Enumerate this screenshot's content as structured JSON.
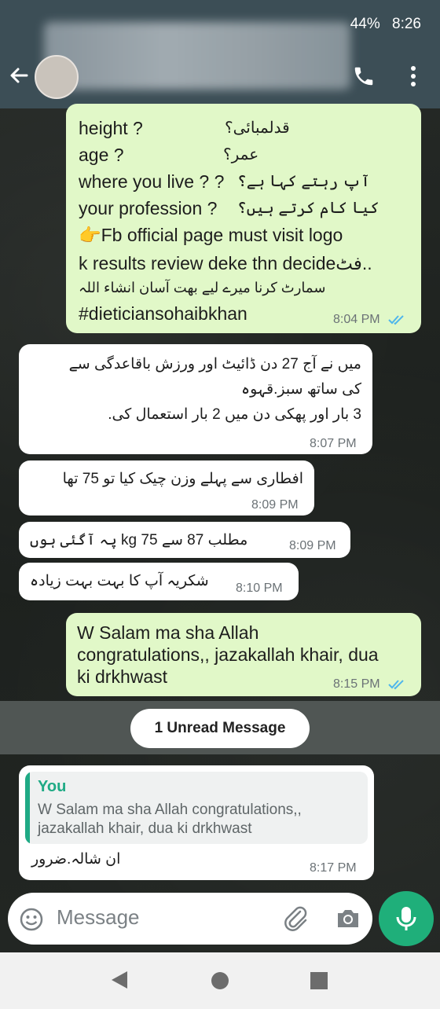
{
  "status_bar": {
    "battery": "44%",
    "time": "8:26"
  },
  "header": {
    "contact_name": ""
  },
  "messages": {
    "m1": {
      "lines": [
        "height ?",
        "قدلمبائی؟",
        "age  ?",
        "عمر؟",
        "where you live ?  ?",
        "آپ رہتے کہا ہے؟",
        "your profession ?",
        "کیا کام کرتے ہیں؟",
        "👉Fb official page must visit logo",
        "k results review deke thn decideفٹ..",
        "سمارٹ کرنا میرے لیے بھت آسان انشاء اللہ",
        "#dieticiansohaibkhan"
      ],
      "time": "8:04 PM"
    },
    "m2": {
      "lines": [
        "میں نے آج 27 دن ڈائیٹ اور ورزش باقاعدگی سے",
        "کی ساتھ سبز.قہوہ",
        "3 بار اور پھکی دن میں 2 بار استعمال کی."
      ],
      "time": "8:07 PM"
    },
    "m3": {
      "text": "افطاری سے پہلے وزن چیک کیا تو 75 تھا",
      "time": "8:09 PM"
    },
    "m4": {
      "text": "مطلب 87 سے 75 kg پہ آگئی ہوں",
      "time": "8:09 PM"
    },
    "m5": {
      "text": "شکریہ آپ کا بہت بہت زیادہ",
      "time": "8:10 PM"
    },
    "m6": {
      "lines": [
        "W Salam ma sha Allah",
        "congratulations,, jazakallah khair,  dua",
        "ki drkhwast"
      ],
      "time": "8:15 PM"
    },
    "unread": "1 Unread Message",
    "m7": {
      "quote_author": "You",
      "quote_lines": [
        "W Salam ma sha Allah congratulations,,",
        "jazakallah khair,  dua ki drkhwast"
      ],
      "text": "ان شالہ.ضرور",
      "time": "8:17 PM"
    }
  },
  "composer": {
    "placeholder": "Message"
  },
  "colors": {
    "header": "#3c4e56",
    "outgoing_bubble": "#e1f8c8",
    "incoming_bubble": "#ffffff",
    "read_ticks": "#4fb6ec",
    "quote_accent": "#1faa85",
    "mic_button": "#1faf7a"
  },
  "icons": {
    "back": "arrow-left-icon",
    "call": "phone-icon",
    "menu": "more-vertical-icon",
    "emoji": "emoji-icon",
    "attach": "paperclip-icon",
    "camera": "camera-icon",
    "mic": "microphone-icon"
  }
}
